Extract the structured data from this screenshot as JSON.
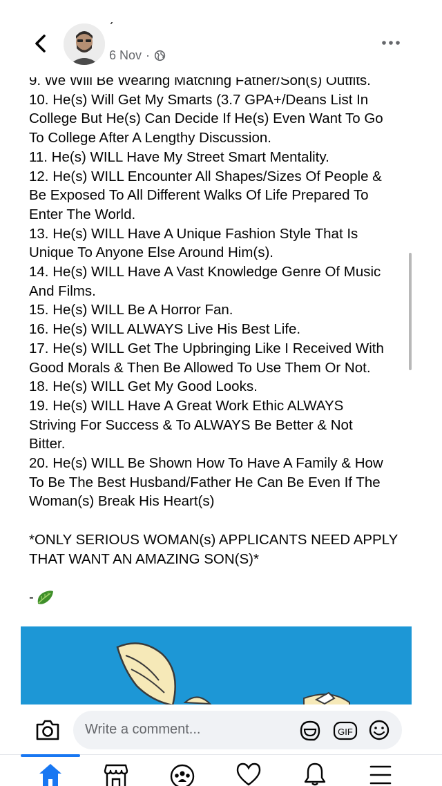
{
  "header": {
    "author_name": "ˊ",
    "date": "6 Nov",
    "separator": "·",
    "icons": {
      "back": "chevron-left-icon",
      "privacy": "globe-icon",
      "more": "more-horizontal-icon"
    }
  },
  "post": {
    "lines": [
      "9. We Will Be Wearing Matching Father/Son(s) Outfits.",
      "10. He(s) Will Get My Smarts (3.7 GPA+/Deans List In",
      "College But He(s) Can Decide If He(s) Even Want To Go",
      "To College After A Lengthy Discussion.",
      "11. He(s) WILL Have My Street Smart Mentality.",
      "12. He(s) WILL Encounter All Shapes/Sizes Of People &",
      "Be Exposed To All Different Walks Of Life Prepared To",
      "Enter The World.",
      "13. He(s) WILL Have A Unique Fashion Style That Is",
      "Unique To Anyone Else Around Him(s).",
      "14. He(s) WILL Have A Vast Knowledge Genre Of Music",
      "And Films.",
      "15. He(s) WILL Be A Horror Fan.",
      "16. He(s) WILL ALWAYS Live His Best Life.",
      "17. He(s) WILL Get The Upbringing Like I Received With",
      "Good Morals & Then Be Allowed To Use Them Or Not.",
      "18. He(s) WILL Get My Good Looks.",
      "19. He(s) WILL Have A Great Work Ethic ALWAYS",
      "Striving For Success & To ALWAYS Be Better & Not",
      "Bitter.",
      "20. He(s) WILL Be Shown How To Have A Family & How",
      "To Be The Best Husband/Father He Can Be Even If The",
      "Woman(s) Break His Heart(s)",
      "",
      "*ONLY SERIOUS WOMAN(s) APPLICANTS NEED APPLY",
      "THAT WANT AN AMAZING SON(S)*",
      ""
    ],
    "signature_prefix": "-",
    "signature_icon": "leafy-green-emoji-icon"
  },
  "comment_bar": {
    "placeholder": "Write a comment...",
    "gif_label": "GIF",
    "icons": {
      "camera": "camera-icon",
      "sticker": "sticker-icon",
      "emoji": "smiley-icon"
    }
  },
  "bottom_nav": {
    "items": [
      {
        "name": "home",
        "icon": "home-icon",
        "active": true
      },
      {
        "name": "marketplace",
        "icon": "marketplace-icon",
        "active": false
      },
      {
        "name": "groups",
        "icon": "groups-icon",
        "active": false
      },
      {
        "name": "dating",
        "icon": "heart-icon",
        "active": false
      },
      {
        "name": "notifications",
        "icon": "bell-icon",
        "active": false
      },
      {
        "name": "menu",
        "icon": "menu-icon",
        "active": false
      }
    ]
  },
  "colors": {
    "accent": "#1877f2",
    "secondary_text": "#65676b",
    "input_bg": "#f0f2f5",
    "image_bg": "#1d97d6",
    "leaf": "#3f8f2a"
  }
}
